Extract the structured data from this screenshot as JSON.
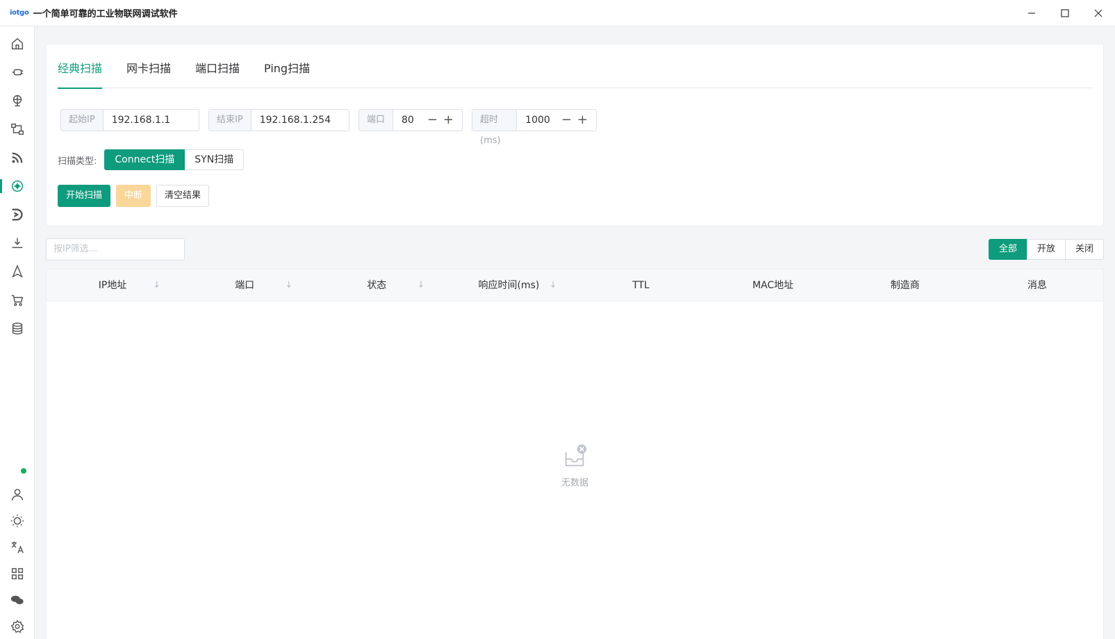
{
  "titlebar": {
    "logo": "iotgo",
    "title": "一个简单可靠的工业物联网调试软件"
  },
  "sidebar": {
    "items": [
      {
        "icon": "home-icon",
        "active": false
      },
      {
        "icon": "plug-icon",
        "active": false
      },
      {
        "icon": "globe-icon",
        "active": false
      },
      {
        "icon": "flow-icon",
        "active": false
      },
      {
        "icon": "rss-icon",
        "active": false
      },
      {
        "icon": "target-icon",
        "active": true
      },
      {
        "icon": "d-logo-icon",
        "active": false
      },
      {
        "icon": "download-icon",
        "active": false
      },
      {
        "icon": "navigation-icon",
        "active": false
      },
      {
        "icon": "cart-icon",
        "active": false
      },
      {
        "icon": "database-icon",
        "active": false
      }
    ],
    "bottom_items": [
      {
        "icon": "user-icon"
      },
      {
        "icon": "sun-icon"
      },
      {
        "icon": "translate-icon"
      },
      {
        "icon": "grid-icon"
      },
      {
        "icon": "chat-icon"
      },
      {
        "icon": "settings-icon"
      }
    ],
    "status_color": "#1aad5c"
  },
  "tabs": [
    {
      "label": "经典扫描",
      "active": true
    },
    {
      "label": "网卡扫描",
      "active": false
    },
    {
      "label": "端口扫描",
      "active": false
    },
    {
      "label": "Ping扫描",
      "active": false
    }
  ],
  "fields": {
    "start_ip": {
      "label": "起始IP",
      "value": "192.168.1.1"
    },
    "end_ip": {
      "label": "结束IP",
      "value": "192.168.1.254"
    },
    "port": {
      "label": "端口",
      "value": "80"
    },
    "timeout": {
      "label": "超时(ms)",
      "value": "1000"
    }
  },
  "scan_type": {
    "label": "扫描类型:",
    "options": [
      "Connect扫描",
      "SYN扫描"
    ],
    "selected": "Connect扫描"
  },
  "actions": {
    "start": "开始扫描",
    "stop": "中断",
    "clear": "清空结果"
  },
  "filter": {
    "placeholder": "按IP筛选...",
    "options": [
      "全部",
      "开放",
      "关闭"
    ],
    "selected": "全部"
  },
  "table": {
    "columns": [
      "IP地址",
      "端口",
      "状态",
      "响应时间(ms)",
      "TTL",
      "MAC地址",
      "制造商",
      "消息"
    ],
    "sortable": [
      true,
      true,
      true,
      true,
      false,
      false,
      false,
      false
    ],
    "rows": [],
    "empty_text": "无数据"
  },
  "colors": {
    "accent": "#0f9b7d",
    "warning_disabled": "#f9d79a"
  }
}
